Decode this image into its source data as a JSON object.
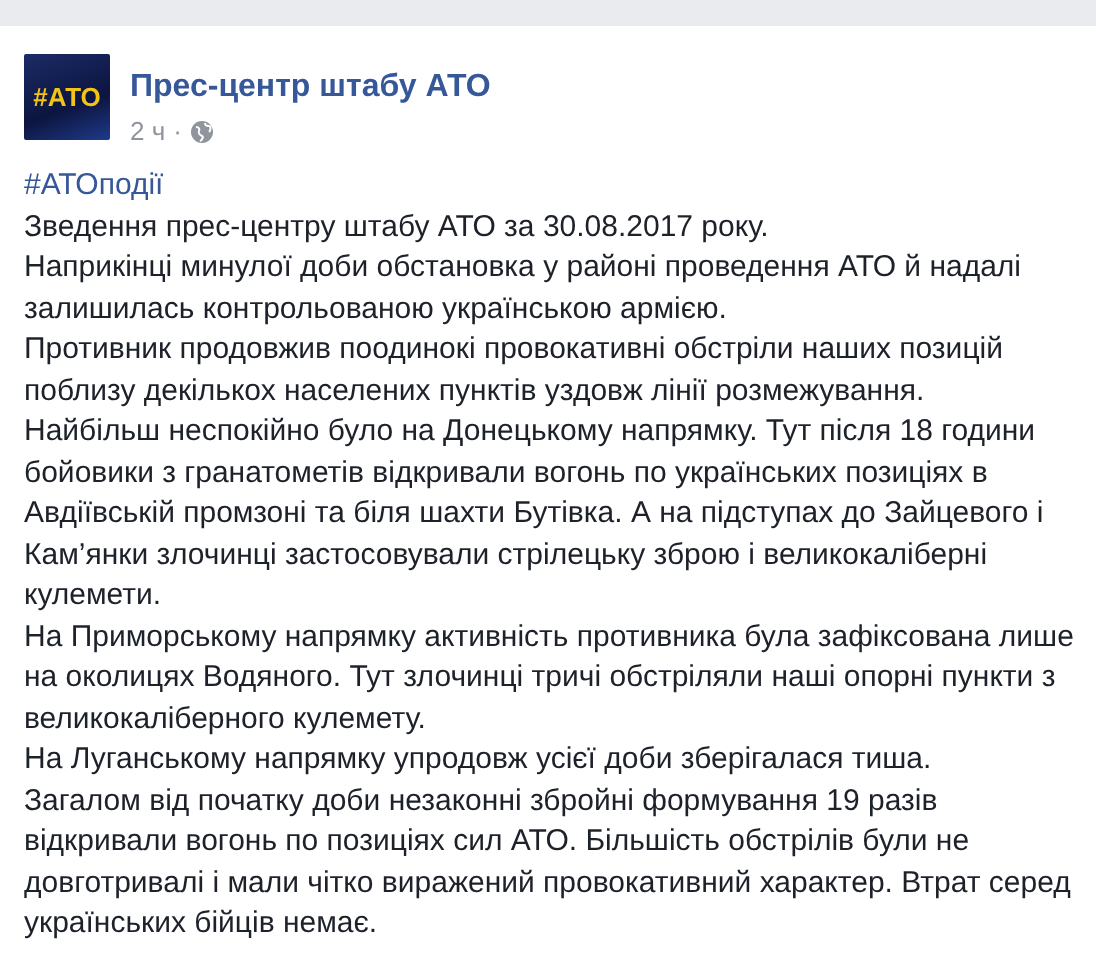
{
  "post": {
    "author": "Прес-центр штабу АТО",
    "avatar_text": "#АТО",
    "time": "2 ч",
    "separator": "·",
    "hashtag": "#АТОподії",
    "paragraphs": [
      "Зведення прес-центру штабу АТО за 30.08.2017 року.",
      "Наприкінці минулої доби обстановка у районі проведення АТО й надалі залишилась контрольованою українською армією.",
      "Противник продовжив поодинокі провокативні обстріли наших позицій поблизу декількох населених пунктів уздовж лінії розмежування.",
      "Найбільш неспокійно було на Донецькому напрямку. Тут після 18 години бойовики з гранатометів відкривали вогонь по українських позиціях в Авдіївській промзоні та біля шахти Бутівка. А на підступах до Зайцевого і Кам’янки злочинці застосовували стрілецьку зброю і великокаліберні кулемети.",
      "На Приморському напрямку активність противника була зафіксована лише на околицях Водяного. Тут злочинці тричі обстріляли наші опорні пункти з великокаліберного кулемету.",
      "На Луганському напрямку упродовж усієї доби зберігалася тиша.",
      "Загалом від початку доби незаконні збройні формування 19 разів відкривали вогонь по позиціях сил АТО. Більшість обстрілів були не довготривалі і мали чітко виражений провокативний характер. Втрат серед українських бійців немає."
    ]
  }
}
